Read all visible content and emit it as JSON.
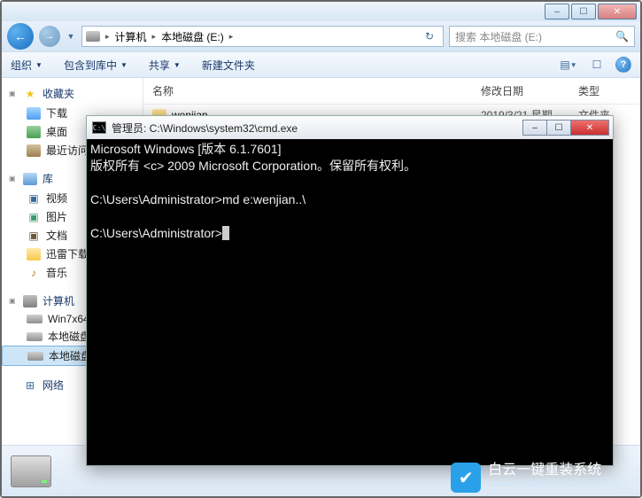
{
  "window_controls": {
    "min": "–",
    "max": "☐",
    "close": "✕"
  },
  "nav": {
    "breadcrumb": {
      "seg1": "计算机",
      "seg2": "本地磁盘 (E:)"
    },
    "search_placeholder": "搜索 本地磁盘 (E:)"
  },
  "toolbar": {
    "organize": "组织",
    "include": "包含到库中",
    "share": "共享",
    "newfolder": "新建文件夹"
  },
  "sidebar": {
    "favorites": {
      "label": "收藏夹",
      "items": [
        {
          "label": "下载"
        },
        {
          "label": "桌面"
        },
        {
          "label": "最近访问"
        }
      ]
    },
    "libraries": {
      "label": "库",
      "items": [
        {
          "label": "视频"
        },
        {
          "label": "图片"
        },
        {
          "label": "文档"
        },
        {
          "label": "迅雷下载"
        },
        {
          "label": "音乐"
        }
      ]
    },
    "computer": {
      "label": "计算机",
      "items": [
        {
          "label": "Win7x64"
        },
        {
          "label": "本地磁盘"
        },
        {
          "label": "本地磁盘"
        }
      ]
    },
    "network": {
      "label": "网络"
    }
  },
  "content": {
    "headers": {
      "name": "名称",
      "date": "修改日期",
      "type": "类型"
    },
    "rows": [
      {
        "name": "wenjian",
        "date": "2019/3/21 星期…",
        "type": "文件夹"
      }
    ]
  },
  "cmd": {
    "title": "管理员: C:\\Windows\\system32\\cmd.exe",
    "lines": [
      "Microsoft Windows [版本 6.1.7601]",
      "版权所有 <c> 2009 Microsoft Corporation。保留所有权利。",
      "",
      "C:\\Users\\Administrator>md e:wenjian..\\",
      "",
      "C:\\Users\\Administrator>"
    ]
  },
  "watermark": {
    "main": "白云一键重装系统",
    "sub": "www.baiyunxitong.com"
  }
}
